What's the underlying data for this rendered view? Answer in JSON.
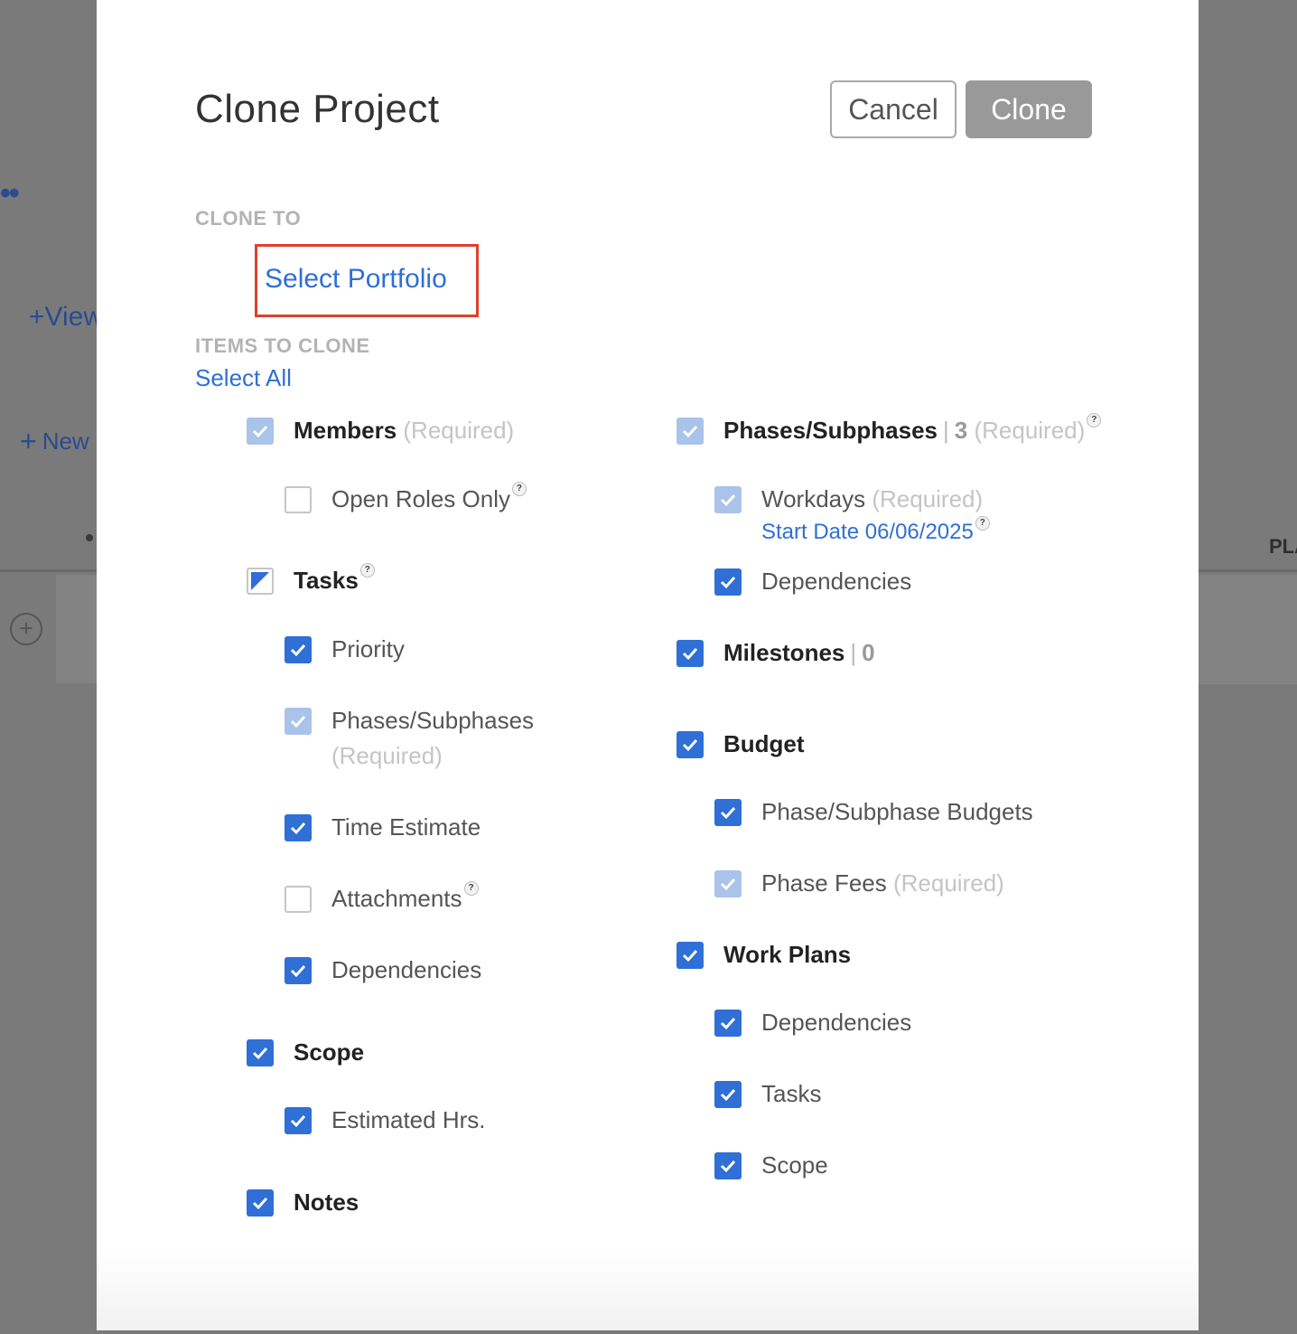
{
  "background": {
    "view_label": "+View",
    "new_label": "New",
    "header_fragment": "PLA"
  },
  "modal": {
    "title": "Clone Project",
    "cancel_label": "Cancel",
    "clone_label": "Clone",
    "clone_to_label": "CLONE TO",
    "select_portfolio_label": "Select Portfolio",
    "items_label": "ITEMS TO CLONE",
    "select_all_label": "Select All",
    "required_text": "(Required)",
    "help_glyph": "?"
  },
  "left_items": {
    "members": "Members",
    "open_roles": "Open Roles Only",
    "tasks": "Tasks",
    "priority": "Priority",
    "phases_subphases": "Phases/Subphases",
    "time_estimate": "Time Estimate",
    "attachments": "Attachments",
    "dependencies": "Dependencies",
    "scope": "Scope",
    "estimated_hrs": "Estimated Hrs.",
    "notes": "Notes"
  },
  "right_items": {
    "phases_subphases": "Phases/Subphases",
    "phases_count": "3",
    "workdays": "Workdays",
    "start_date": "Start Date 06/06/2025",
    "phase_dependencies": "Dependencies",
    "milestones": "Milestones",
    "milestones_count": "0",
    "budget": "Budget",
    "phase_budgets": "Phase/Subphase Budgets",
    "phase_fees": "Phase Fees",
    "work_plans": "Work Plans",
    "wp_dependencies": "Dependencies",
    "wp_tasks": "Tasks",
    "wp_scope": "Scope"
  },
  "checkbox_states": {
    "members": "required",
    "open_roles": "unchecked",
    "tasks": "partial",
    "priority": "checked",
    "task_phases": "required",
    "time_estimate": "checked",
    "attachments": "unchecked",
    "task_dependencies": "checked",
    "scope": "checked",
    "estimated_hrs": "checked",
    "notes": "checked",
    "phases_subphases": "required",
    "workdays": "required",
    "phase_dependencies": "checked",
    "milestones": "checked",
    "budget": "checked",
    "phase_budgets": "checked",
    "phase_fees": "required",
    "work_plans": "checked",
    "wp_dependencies": "checked",
    "wp_tasks": "checked",
    "wp_scope": "checked"
  },
  "colors": {
    "accent": "#2f6fd6",
    "required_check": "#a9c3ea",
    "highlight_border": "#e0402d",
    "clone_button": "#999999"
  }
}
